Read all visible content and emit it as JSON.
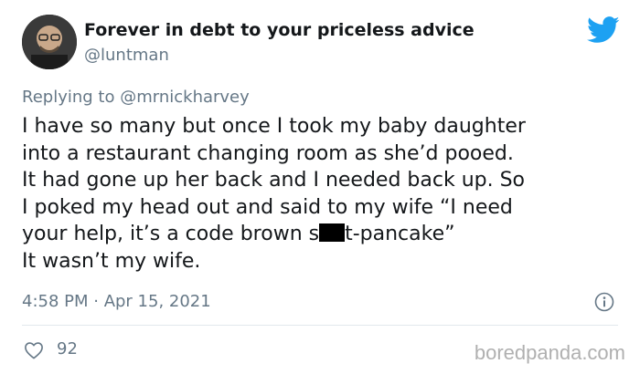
{
  "tweet": {
    "display_name": "Forever in debt to your priceless advice",
    "handle": "@luntman",
    "reply_prefix": "Replying to",
    "reply_mention": "@mrnickharvey",
    "body_lines": [
      "I have so many but once I took my baby daughter",
      "into a restaurant changing room as she’d pooed.",
      "It had gone up her back and I needed back up.  So",
      "I poked my head out and said to my wife “I need",
      {
        "before": "your help, it’s a code brown s",
        "after": "t-pancake”"
      },
      "It wasn’t my wife."
    ],
    "timestamp": "4:58 PM · Apr 15, 2021",
    "likes": "92"
  },
  "icons": {
    "avatar": "avatar",
    "brand": "twitter-bird-icon",
    "info": "info-icon",
    "like": "heart-icon"
  },
  "colors": {
    "brand_blue": "#1da1f2",
    "secondary_text": "#657786",
    "primary_text": "#14171a"
  },
  "watermark": "boredpanda.com"
}
